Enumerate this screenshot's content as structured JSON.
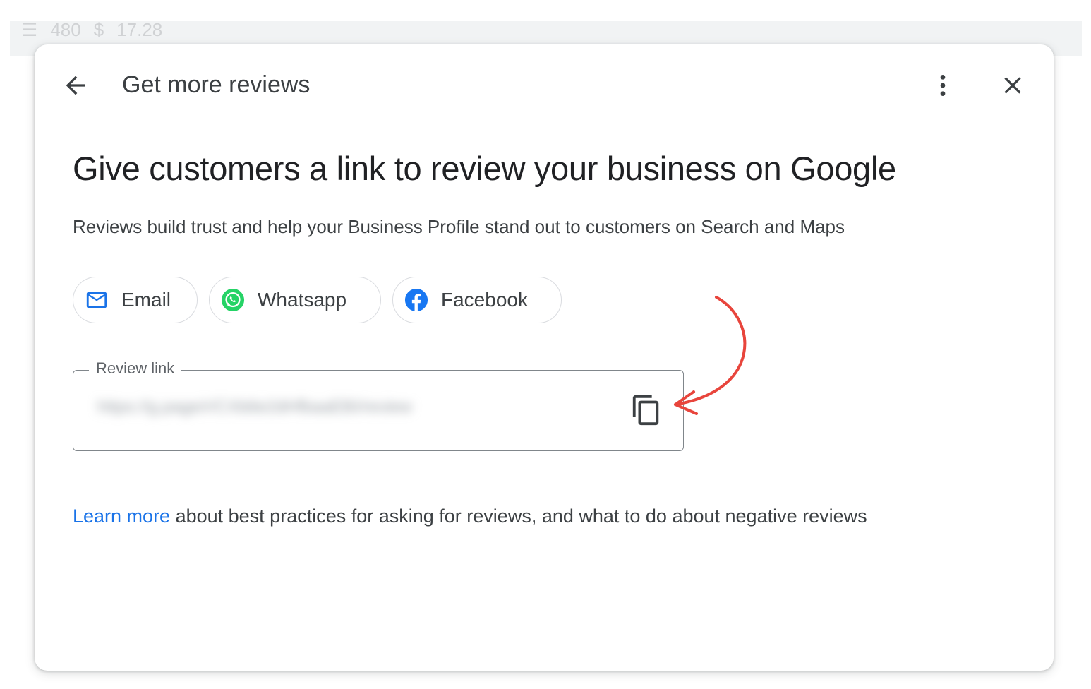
{
  "background_toolbar": {
    "items": [
      "480",
      "$",
      "17.28"
    ]
  },
  "dialog": {
    "header": {
      "title": "Get more reviews",
      "back_icon": "arrow-back-icon",
      "more_icon": "more-vert-icon",
      "close_icon": "close-icon"
    },
    "headline": "Give customers a link to review your business on Google",
    "subtext": "Reviews build trust and help your Business Profile stand out to customers on Search and Maps",
    "share_chips": [
      {
        "label": "Email",
        "icon": "email-icon",
        "color": "#1a73e8"
      },
      {
        "label": "Whatsapp",
        "icon": "whatsapp-icon",
        "color": "#25d366"
      },
      {
        "label": "Facebook",
        "icon": "facebook-icon",
        "color": "#1877f2"
      }
    ],
    "review_link": {
      "label": "Review link",
      "value": "https://g.page/r/CXb6e2dHfbaaEBI/review",
      "copy_icon": "copy-icon"
    },
    "footer": {
      "link_text": "Learn more",
      "text": " about best practices for asking for reviews, and what to do about negative reviews"
    }
  },
  "colors": {
    "link": "#1a73e8",
    "annotation_arrow": "#e8453c",
    "text_primary": "#202124",
    "text_secondary": "#3c4043"
  }
}
